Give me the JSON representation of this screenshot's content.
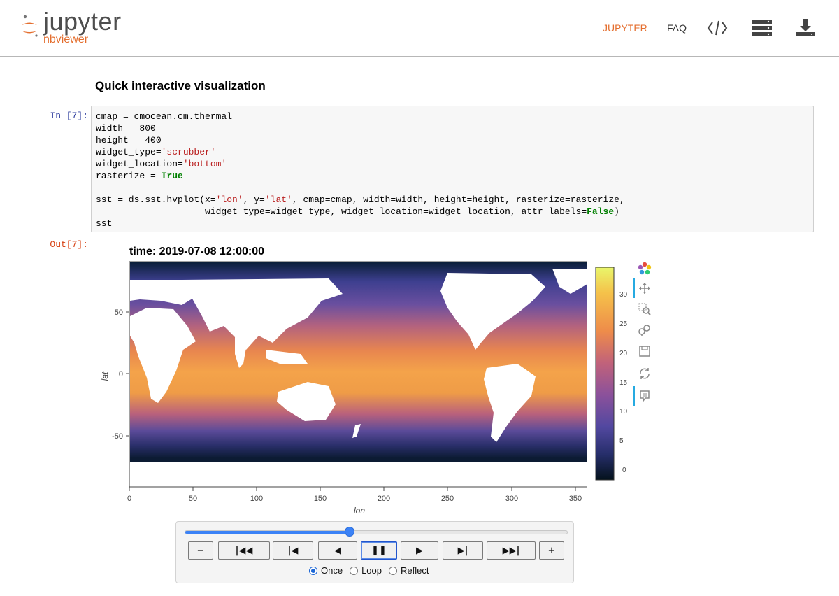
{
  "header": {
    "logo_text": "jupyter",
    "logo_sub": "nbviewer",
    "nav": [
      {
        "label": "JUPYTER",
        "active": true
      },
      {
        "label": "FAQ",
        "active": false
      }
    ],
    "icons": [
      "code-icon",
      "server-icon",
      "download-icon"
    ],
    "accent_color": "#e46e2e"
  },
  "notebook": {
    "heading": "Quick interactive visualization",
    "in_prompt": "In [7]:",
    "out_prompt": "Out[7]:",
    "code_lines": [
      "cmap = cmocean.cm.thermal",
      "width = 800",
      "height = 400",
      "widget_type='scrubber'",
      "widget_location='bottom'",
      "rasterize = True",
      "",
      "sst = ds.sst.hvplot(x='lon', y='lat', cmap=cmap, width=width, height=height, rasterize=rasterize,",
      "                    widget_type=widget_type, widget_location=widget_location, attr_labels=False)",
      "sst"
    ]
  },
  "plot": {
    "title": "time: 2019-07-08 12:00:00",
    "xlabel": "lon",
    "ylabel": "lat",
    "xticks": [
      "0",
      "50",
      "100",
      "150",
      "200",
      "250",
      "300",
      "350"
    ],
    "yticks": [
      "50",
      "0",
      "-50"
    ],
    "colorbar_ticks": [
      "30",
      "25",
      "20",
      "15",
      "10",
      "5",
      "0"
    ],
    "xlim": [
      0,
      360
    ],
    "ylim": [
      -90,
      90
    ],
    "clim": [
      -2,
      34
    ],
    "colormap": "cmocean thermal",
    "tools": [
      "bokeh-logo-icon",
      "pan-icon",
      "box-zoom-icon",
      "wheel-zoom-icon",
      "save-icon",
      "reset-icon",
      "hover-icon"
    ]
  },
  "player": {
    "slider_fraction": 0.43,
    "buttons": [
      {
        "name": "slower-button",
        "glyph": "−"
      },
      {
        "name": "first-frame-button",
        "glyph": "|◀◀"
      },
      {
        "name": "previous-frame-button",
        "glyph": "|◀"
      },
      {
        "name": "play-reverse-button",
        "glyph": "◀"
      },
      {
        "name": "pause-button",
        "glyph": "❚❚"
      },
      {
        "name": "play-button",
        "glyph": "▶"
      },
      {
        "name": "next-frame-button",
        "glyph": "▶|"
      },
      {
        "name": "last-frame-button",
        "glyph": "▶▶|"
      },
      {
        "name": "faster-button",
        "glyph": "+"
      }
    ],
    "active_button": "pause-button",
    "loop_options": [
      "Once",
      "Loop",
      "Reflect"
    ],
    "selected_loop": "Once"
  }
}
